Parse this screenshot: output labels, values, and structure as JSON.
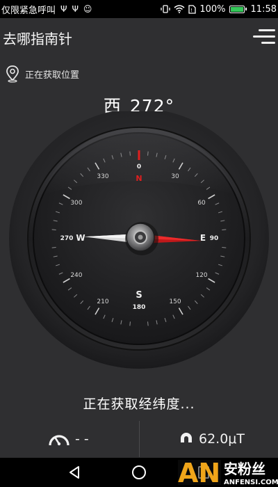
{
  "status_bar": {
    "carrier_text": "仅限紧急呼叫",
    "icons_left": [
      "usb-icon",
      "usb-icon",
      "notification-icon"
    ],
    "battery_percent_text": "100%",
    "battery_level": 1.0,
    "time": "11:58"
  },
  "header": {
    "title": "去哪指南针",
    "menu_icon": "hamburger-menu-icon"
  },
  "location": {
    "icon": "location-pin-icon",
    "text": "正在获取位置"
  },
  "heading": {
    "direction": "西",
    "degrees": "272°",
    "needle_angle": 272
  },
  "compass": {
    "cardinals": {
      "north": "N",
      "south": "S",
      "east": "E",
      "west": "W"
    },
    "cardinal_degrees": {
      "north": "0",
      "south": "180",
      "east": "90",
      "west": "270"
    },
    "dial_numbers": [
      "30",
      "60",
      "120",
      "150",
      "210",
      "240",
      "300",
      "330"
    ],
    "accent_color": "#e01f1f"
  },
  "latlon_status": "正在获取经纬度...",
  "speed": {
    "icon": "speedometer-icon",
    "value": "- -"
  },
  "magnetic": {
    "icon": "magnet-icon",
    "value": "62.0μT"
  },
  "nav_bar": {
    "back": "back-icon",
    "home": "home-icon",
    "recents": "recents-icon"
  },
  "watermark": {
    "logo_text": "AN",
    "name": "安粉丝",
    "url": "ANFENSI.COM"
  }
}
